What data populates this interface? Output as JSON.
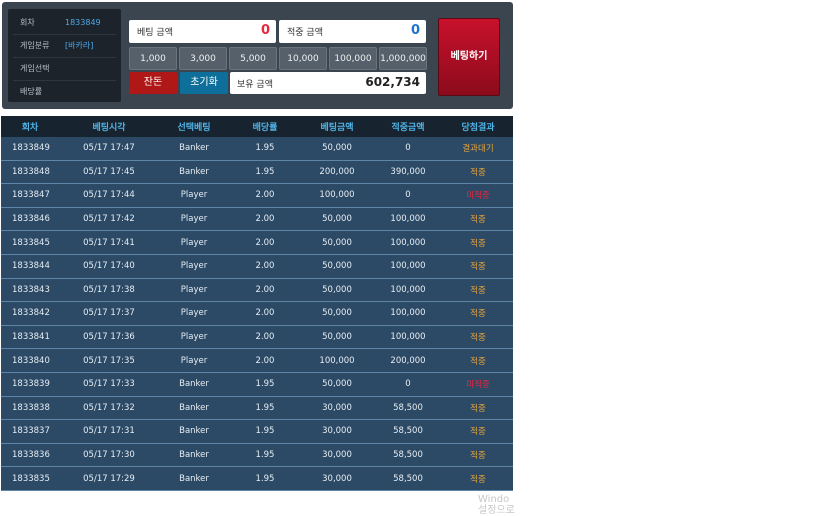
{
  "info": [
    {
      "label": "회차",
      "value": "1833849"
    },
    {
      "label": "게임분류",
      "value": "[바카라]"
    },
    {
      "label": "게임선택",
      "value": ""
    },
    {
      "label": "배당률",
      "value": ""
    }
  ],
  "bet_amount": {
    "label": "베팅 금액",
    "value": "0"
  },
  "win_amount": {
    "label": "적중 금액",
    "value": "0"
  },
  "chips": [
    "1,000",
    "3,000",
    "5,000",
    "10,000",
    "100,000",
    "1,000,000"
  ],
  "change_label": "잔돈",
  "reset_label": "초기화",
  "holding": {
    "label": "보유 금액",
    "value": "602,734"
  },
  "bet_button": "베팅하기",
  "table": {
    "headers": [
      "회차",
      "베팅시각",
      "선택베팅",
      "배당률",
      "베팅금액",
      "적중금액",
      "당첨결과"
    ],
    "rows": [
      [
        "1833849",
        "05/17 17:47",
        "Banker",
        "1.95",
        "50,000",
        "0",
        "결과대기"
      ],
      [
        "1833848",
        "05/17 17:45",
        "Banker",
        "1.95",
        "200,000",
        "390,000",
        "적중"
      ],
      [
        "1833847",
        "05/17 17:44",
        "Player",
        "2.00",
        "100,000",
        "0",
        "미적중"
      ],
      [
        "1833846",
        "05/17 17:42",
        "Player",
        "2.00",
        "50,000",
        "100,000",
        "적중"
      ],
      [
        "1833845",
        "05/17 17:41",
        "Player",
        "2.00",
        "50,000",
        "100,000",
        "적중"
      ],
      [
        "1833844",
        "05/17 17:40",
        "Player",
        "2.00",
        "50,000",
        "100,000",
        "적중"
      ],
      [
        "1833843",
        "05/17 17:38",
        "Player",
        "2.00",
        "50,000",
        "100,000",
        "적중"
      ],
      [
        "1833842",
        "05/17 17:37",
        "Player",
        "2.00",
        "50,000",
        "100,000",
        "적중"
      ],
      [
        "1833841",
        "05/17 17:36",
        "Player",
        "2.00",
        "50,000",
        "100,000",
        "적중"
      ],
      [
        "1833840",
        "05/17 17:35",
        "Player",
        "2.00",
        "100,000",
        "200,000",
        "적중"
      ],
      [
        "1833839",
        "05/17 17:33",
        "Banker",
        "1.95",
        "50,000",
        "0",
        "미적중"
      ],
      [
        "1833838",
        "05/17 17:32",
        "Banker",
        "1.95",
        "30,000",
        "58,500",
        "적중"
      ],
      [
        "1833837",
        "05/17 17:31",
        "Banker",
        "1.95",
        "30,000",
        "58,500",
        "적중"
      ],
      [
        "1833836",
        "05/17 17:30",
        "Banker",
        "1.95",
        "30,000",
        "58,500",
        "적중"
      ],
      [
        "1833835",
        "05/17 17:29",
        "Banker",
        "1.95",
        "30,000",
        "58,500",
        "적중"
      ]
    ]
  },
  "watermark": [
    "Windo",
    "설정으로"
  ],
  "colors": {
    "bet_value": "#e8263d",
    "win_value": "#1e73c8",
    "header_text": "#4fb3e6",
    "result_hit": "#e6a33b",
    "result_miss": "#e8263d"
  }
}
